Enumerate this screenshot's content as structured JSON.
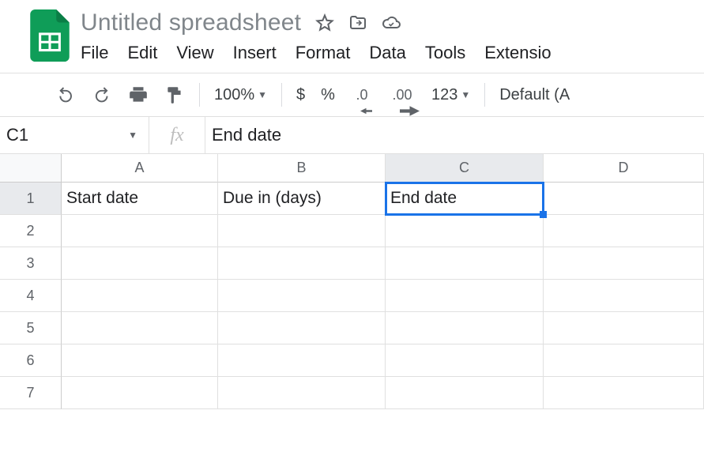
{
  "doc": {
    "title": "Untitled spreadsheet"
  },
  "menu": {
    "file": "File",
    "edit": "Edit",
    "view": "View",
    "insert": "Insert",
    "format": "Format",
    "data": "Data",
    "tools": "Tools",
    "extensions": "Extensio"
  },
  "toolbar": {
    "zoom": "100%",
    "currency": "$",
    "percent": "%",
    "dec_decrease": ".0",
    "dec_increase": ".00",
    "more_formats": "123",
    "font": "Default (A"
  },
  "formula": {
    "name_box": "C1",
    "fx_label": "fx",
    "value": "End date"
  },
  "grid": {
    "columns": [
      "A",
      "B",
      "C",
      "D"
    ],
    "active_column_index": 2,
    "rows": [
      1,
      2,
      3,
      4,
      5,
      6,
      7
    ],
    "active_row_index": 0,
    "cells": {
      "A1": "Start date",
      "B1": "Due in (days)",
      "C1": "End date"
    },
    "selected_cell": "C1"
  }
}
